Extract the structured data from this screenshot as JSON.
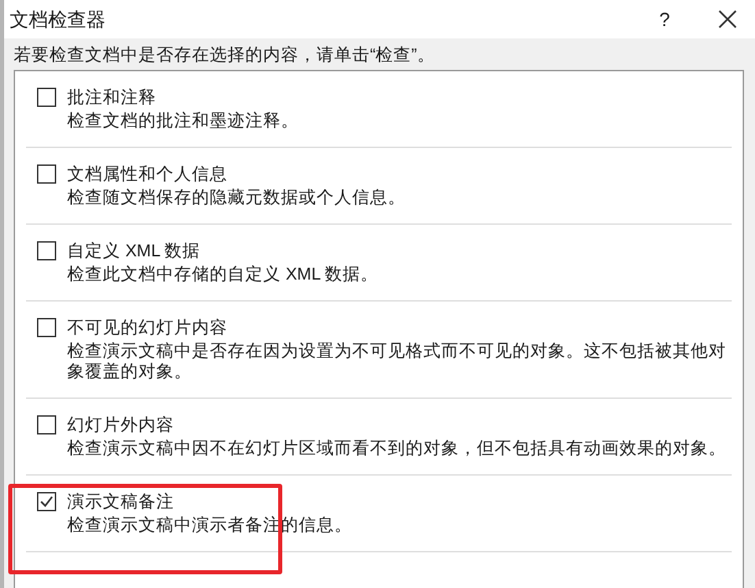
{
  "window": {
    "title": "文档检查器",
    "help": "?"
  },
  "instruction": "若要检查文档中是否存在选择的内容，请单击“检查”。",
  "items": [
    {
      "title": "批注和注释",
      "description": "检查文档的批注和墨迹注释。",
      "checked": false,
      "highlighted": false
    },
    {
      "title": "文档属性和个人信息",
      "description": "检查随文档保存的隐藏元数据或个人信息。",
      "checked": false,
      "highlighted": false
    },
    {
      "title": "自定义 XML 数据",
      "description": "检查此文档中存储的自定义 XML 数据。",
      "checked": false,
      "highlighted": false
    },
    {
      "title": "不可见的幻灯片内容",
      "description": "检查演示文稿中是否存在因为设置为不可见格式而不可见的对象。这不包括被其他对象覆盖的对象。",
      "checked": false,
      "highlighted": false
    },
    {
      "title": "幻灯片外内容",
      "description": "检查演示文稿中因不在幻灯片区域而看不到的对象，但不包括具有动画效果的对象。",
      "checked": false,
      "highlighted": false
    },
    {
      "title": "演示文稿备注",
      "description": "检查演示文稿中演示者备注的信息。",
      "checked": true,
      "highlighted": true
    }
  ]
}
